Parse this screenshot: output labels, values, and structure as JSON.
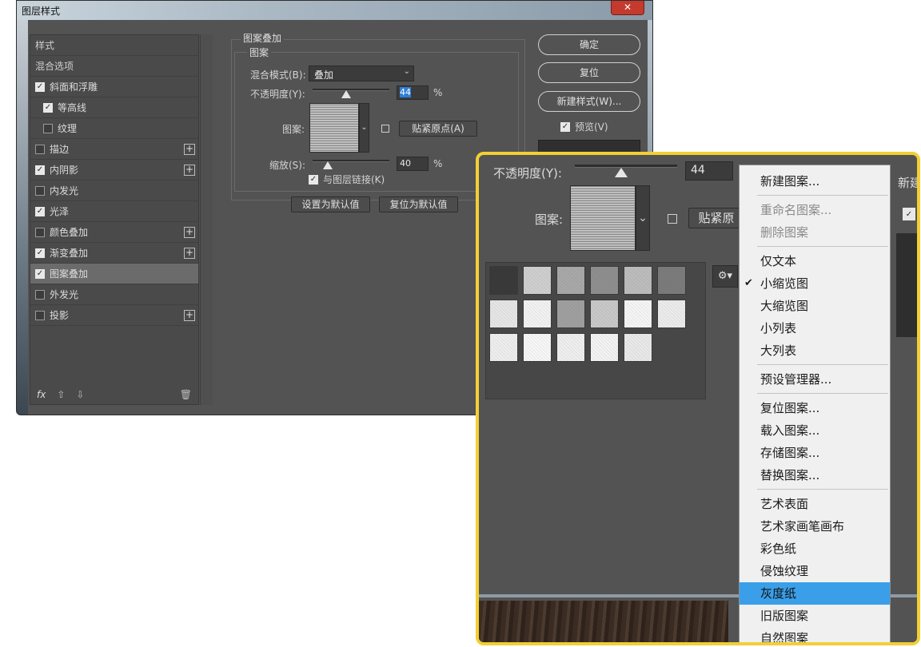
{
  "dialog": {
    "title": "图层样式",
    "close": "✕",
    "styles": [
      {
        "label": "样式",
        "type": "header"
      },
      {
        "label": "混合选项",
        "type": "header"
      },
      {
        "label": "斜面和浮雕",
        "checked": true
      },
      {
        "label": "等高线",
        "checked": true,
        "indent": true
      },
      {
        "label": "纹理",
        "checked": false,
        "indent": true
      },
      {
        "label": "描边",
        "checked": false,
        "plus": true
      },
      {
        "label": "内阴影",
        "checked": true,
        "plus": true
      },
      {
        "label": "内发光",
        "checked": false
      },
      {
        "label": "光泽",
        "checked": true
      },
      {
        "label": "颜色叠加",
        "checked": false,
        "plus": true
      },
      {
        "label": "渐变叠加",
        "checked": true,
        "plus": true
      },
      {
        "label": "图案叠加",
        "checked": true,
        "selected": true
      },
      {
        "label": "外发光",
        "checked": false
      },
      {
        "label": "投影",
        "checked": false,
        "plus": true
      }
    ],
    "footer": {
      "fx": "fx",
      "up": "⇧",
      "down": "⇩",
      "trash": "🗑"
    },
    "section_title": "图案叠加",
    "subsection_title": "图案",
    "blend_mode_label": "混合模式(B):",
    "blend_mode_value": "叠加",
    "opacity_label": "不透明度(Y):",
    "opacity_value": "44",
    "opacity_level": 0.44,
    "pattern_label": "图案:",
    "snap_button": "贴紧原点(A)",
    "scale_label": "缩放(S):",
    "scale_value": "40",
    "scale_level": 0.2,
    "percent": "%",
    "link_label": "与图层链接(K)",
    "link_checked": true,
    "set_default": "设置为默认值",
    "reset_default": "复位为默认值",
    "ok": "确定",
    "reset": "复位",
    "new_style": "新建样式(W)...",
    "preview_label": "预览(V)",
    "preview_checked": true
  },
  "zoom": {
    "opacity_label": "不透明度(Y):",
    "opacity_value": "44",
    "pattern_label": "图案:",
    "snap_partial": "贴紧原",
    "new_partial": "新建",
    "gear": "⚙▾",
    "menu": {
      "items": [
        {
          "label": "新建图案...",
          "group": 0
        },
        {
          "label": "重命名图案...",
          "group": 1,
          "disabled": true
        },
        {
          "label": "删除图案",
          "group": 1,
          "disabled": true
        },
        {
          "label": "仅文本",
          "group": 2
        },
        {
          "label": "小缩览图",
          "group": 2,
          "checked": true
        },
        {
          "label": "大缩览图",
          "group": 2
        },
        {
          "label": "小列表",
          "group": 2
        },
        {
          "label": "大列表",
          "group": 2
        },
        {
          "label": "预设管理器...",
          "group": 3
        },
        {
          "label": "复位图案...",
          "group": 4
        },
        {
          "label": "载入图案...",
          "group": 4
        },
        {
          "label": "存储图案...",
          "group": 4
        },
        {
          "label": "替换图案...",
          "group": 4
        },
        {
          "label": "艺术表面",
          "group": 5
        },
        {
          "label": "艺术家画笔画布",
          "group": 5
        },
        {
          "label": "彩色纸",
          "group": 5
        },
        {
          "label": "侵蚀纹理",
          "group": 5
        },
        {
          "label": "灰度纸",
          "group": 5,
          "highlighted": true
        },
        {
          "label": "旧版图案",
          "group": 5
        },
        {
          "label": "自然图案",
          "group": 5
        }
      ]
    },
    "check_mark": "✔"
  }
}
